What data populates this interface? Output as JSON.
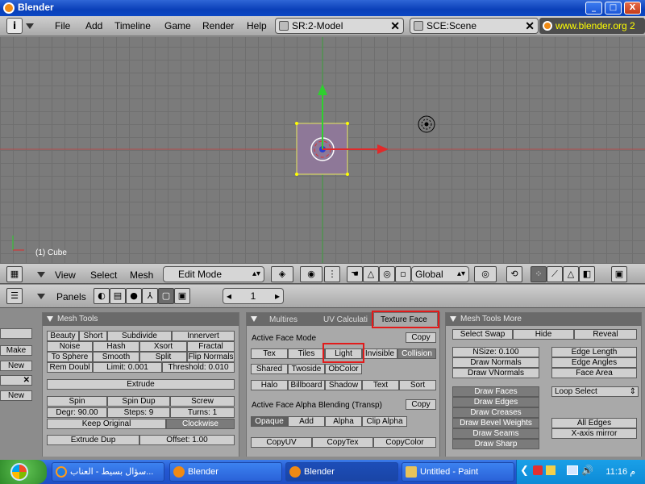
{
  "window": {
    "title": "Blender",
    "buttons": [
      "_",
      "□",
      "X"
    ]
  },
  "top_header": {
    "menus": [
      "File",
      "Add",
      "Timeline",
      "Game",
      "Render",
      "Help"
    ],
    "screen_field": "SR:2-Model",
    "scene_field": "SCE:Scene",
    "url": "www.blender.org 2"
  },
  "viewport": {
    "object_label": "(1) Cube"
  },
  "view3d_header": {
    "menus": [
      "View",
      "Select",
      "Mesh"
    ],
    "mode": "Edit Mode",
    "orientation": "Global"
  },
  "buttons_header": {
    "panels_label": "Panels",
    "frame": "1"
  },
  "mesh_tools": {
    "title": "Mesh Tools",
    "left_col": [
      "Make",
      "New",
      "New"
    ],
    "row1": [
      "Beauty",
      "Short",
      "Subdivide",
      "Innervert"
    ],
    "row2": [
      "Noise",
      "Hash",
      "Xsort",
      "Fractal"
    ],
    "row3": [
      "To Sphere",
      "Smooth",
      "Split",
      "Flip Normals"
    ],
    "row4": [
      "Rem Doubl",
      "Limit: 0.001",
      "Threshold: 0.010"
    ],
    "extrude": "Extrude",
    "row5": [
      "Spin",
      "Spin Dup",
      "Screw"
    ],
    "row6": [
      "Degr: 90.00",
      "Steps: 9",
      "Turns: 1"
    ],
    "row7": [
      "Keep Original",
      "Clockwise"
    ],
    "row8": [
      "Extrude Dup",
      "Offset: 1.00"
    ]
  },
  "texture_face": {
    "tabs": [
      "Multires",
      "UV Calculati",
      "Texture Face"
    ],
    "active_mode_label": "Active Face Mode",
    "copy": "Copy",
    "row1": [
      "Tex",
      "Tiles",
      "Light",
      "Invisible",
      "Collision"
    ],
    "row2": [
      "Shared",
      "Twoside",
      "ObColor"
    ],
    "row3": [
      "Halo",
      "Billboard",
      "Shadow",
      "Text",
      "Sort"
    ],
    "alpha_label": "Active Face Alpha Blending (Transp)",
    "row4": [
      "Opaque",
      "Add",
      "Alpha",
      "Clip Alpha"
    ],
    "row5": [
      "CopyUV",
      "CopyTex",
      "CopyColor"
    ]
  },
  "mesh_tools_more": {
    "title": "Mesh Tools More",
    "row1": [
      "Select Swap",
      "Hide",
      "Reveal"
    ],
    "nsize": "NSize: 0.100",
    "left": [
      "Draw Normals",
      "Draw VNormals"
    ],
    "right": [
      "Edge Length",
      "Edge Angles",
      "Face Area"
    ],
    "draw": [
      "Draw Faces",
      "Draw Edges",
      "Draw Creases",
      "Draw Bevel Weights",
      "Draw Seams",
      "Draw Sharp"
    ],
    "loop_select": "Loop Select",
    "all_edges": "All Edges",
    "x_mirror": "X-axis mirror"
  },
  "taskbar": {
    "tasks": [
      "سؤال بسيط - العناب...",
      "Blender",
      "Blender",
      "Untitled - Paint"
    ],
    "clock": "11:16 م"
  }
}
